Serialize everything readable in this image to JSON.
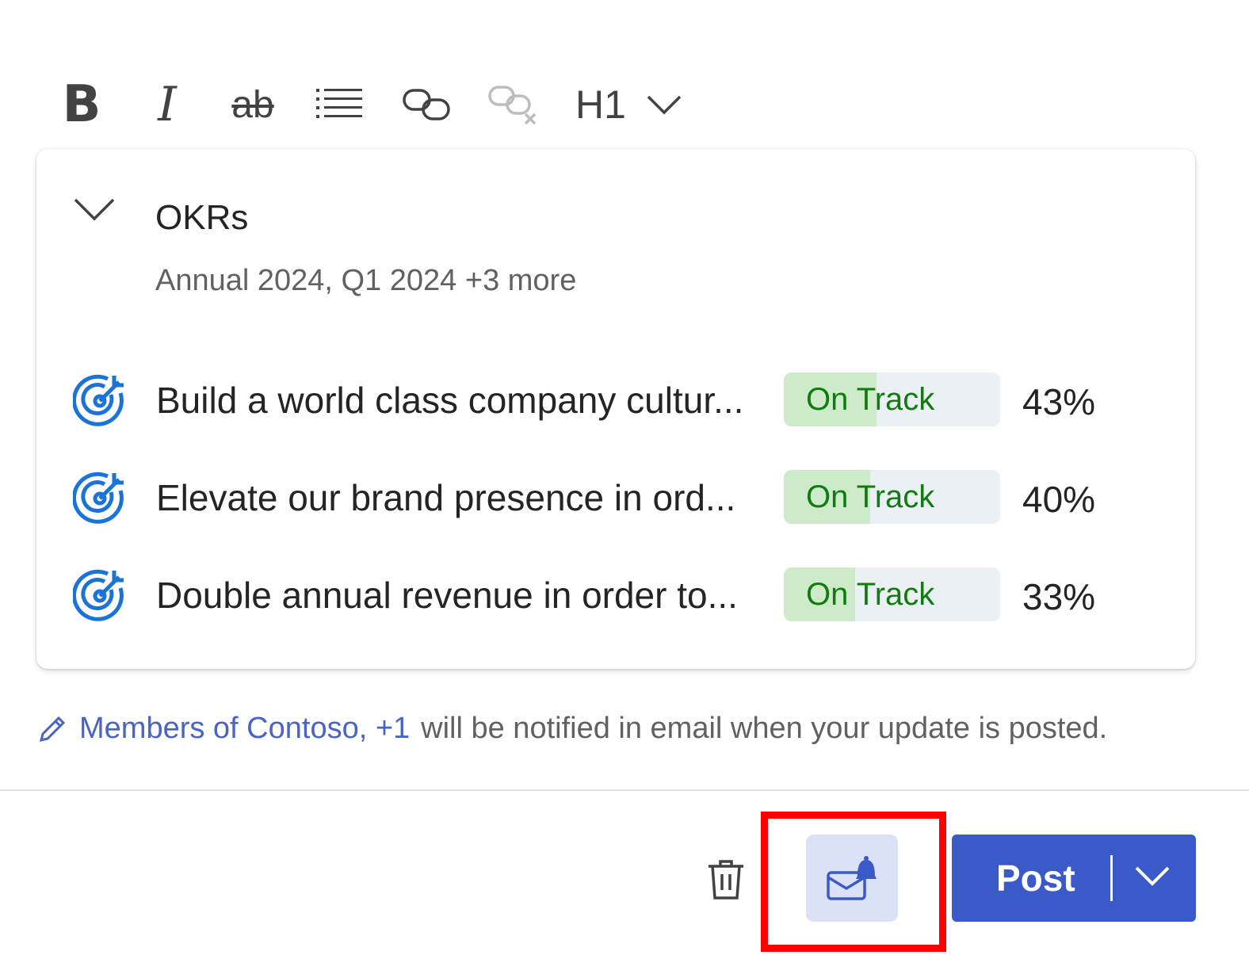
{
  "toolbar": {
    "bold_label": "B",
    "italic_label": "I",
    "strike_label": "ab",
    "heading_label": "H1"
  },
  "okr_card": {
    "title": "OKRs",
    "subtitle": "Annual 2024, Q1 2024 +3 more",
    "rows": [
      {
        "objective": "Build a world class company cultur...",
        "status": "On Track",
        "progress": 0.43,
        "percent": "43%"
      },
      {
        "objective": "Elevate our brand presence in ord...",
        "status": "On Track",
        "progress": 0.4,
        "percent": "40%"
      },
      {
        "objective": "Double annual revenue in order to...",
        "status": "On Track",
        "progress": 0.33,
        "percent": "33%"
      }
    ]
  },
  "notification": {
    "recipients": "Members of Contoso, +1",
    "text": "will be notified in email when your update is posted."
  },
  "footer": {
    "post_label": "Post"
  },
  "colors": {
    "accent": "#3a5bc7",
    "link": "#4a63c7",
    "status_text": "#107c10",
    "status_fill": "#cdebc9",
    "status_track": "#ebf0f5",
    "target_icon": "#1a73d9",
    "highlight": "#ff0000"
  },
  "icons": [
    "bold-icon",
    "italic-icon",
    "strikethrough-icon",
    "bulleted-list-icon",
    "link-icon",
    "remove-link-icon",
    "chevron-down-icon",
    "target-icon",
    "pencil-icon",
    "trash-icon",
    "mail-bell-icon"
  ]
}
